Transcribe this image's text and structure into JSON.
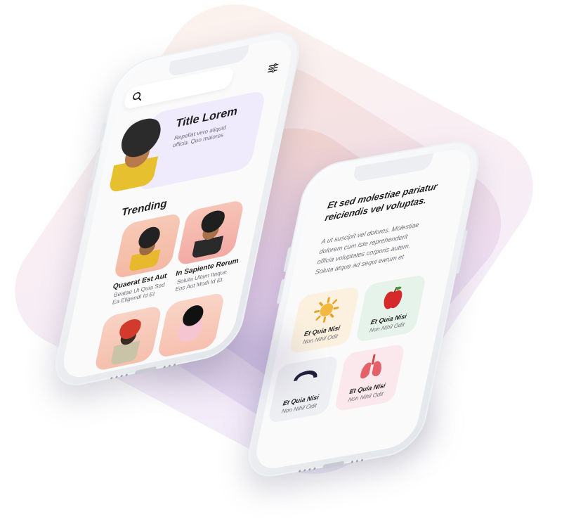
{
  "left_phone": {
    "hero": {
      "title": "Title Lorem",
      "subtitle_line1": "Repellat vero aliquid",
      "subtitle_line2": "officia. Quo maiores"
    },
    "section_title": "Trending",
    "cards": [
      {
        "title": "Quaerat Est Aut",
        "sub1": "Beatae Ut Quia Sed",
        "sub2": "Ea Eligendi Id Et"
      },
      {
        "title": "In Sapiente Rerum",
        "sub1": "Soluta Ullam Itaque",
        "sub2": "Eos Aut Modi Id Et."
      }
    ],
    "icons": {
      "search": "search-icon",
      "filter": "sliders-icon"
    }
  },
  "right_phone": {
    "headline_line1": "Et sed molestiae pariatur",
    "headline_line2": "reiciendis vel  voluptas.",
    "body_line1": "A ut suscipit vel dolores. Molestiae",
    "body_line2": "dolorem cum iste reprehenderit",
    "body_line3": "officia voluptates corporis autem.",
    "body_line4": "Soluta atque ad sequi earum et",
    "tiles": [
      {
        "label": "Et Quia Nisi",
        "sub": "Non Nihil Odit",
        "icon": "sun-icon"
      },
      {
        "label": "Et Quia Nisi",
        "sub": "Non Nihil Odit",
        "icon": "apple-icon"
      },
      {
        "label": "Et Quia Nisi",
        "sub": "Non Nihil Odit",
        "icon": "object-icon"
      },
      {
        "label": "Et Quia Nisi",
        "sub": "Non Nihil Odit",
        "icon": "lungs-icon"
      }
    ]
  },
  "colors": {
    "hero_bg": "#efeafc",
    "card_peach": "#f7c9b6",
    "tile_yellow": "#fbf1de",
    "tile_green": "#e6f3ea",
    "tile_gray": "#eeeff2",
    "tile_pink": "#fbe8ec"
  }
}
